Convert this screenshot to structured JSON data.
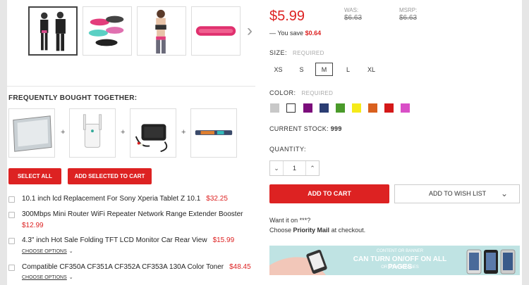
{
  "gallery": {
    "thumbnails": [
      "sportswear-set-thumb",
      "waist-belts-thumb",
      "sports-bra-thumb",
      "pink-belt-thumb"
    ],
    "next_icon": "›"
  },
  "fbt": {
    "title": "FREQUENTLY BOUGHT TOGETHER:",
    "plus": "+",
    "select_all_label": "SELECT ALL",
    "add_selected_label": "ADD SELECTED TO CART",
    "items": [
      {
        "name": "10.1 inch lcd Replacement For Sony Xperia Tablet Z 10.1",
        "price": "$32.25"
      },
      {
        "name": "300Mbps Mini Router WiFi Repeater Network Range Extender Booster",
        "price": "$12.99"
      },
      {
        "name": "4.3\" inch Hot Sale Folding TFT LCD Monitor Car Rear View",
        "price": "$15.99",
        "options": "CHOOSE OPTIONS"
      },
      {
        "name": "Compatible CF350A CF351A CF352A CF353A 130A Color Toner",
        "price": "$48.45",
        "options": "CHOOSE OPTIONS"
      }
    ]
  },
  "price": {
    "current": "$5.99",
    "was_label": "WAS:",
    "was_value": "$6.63",
    "msrp_label": "MSRP:",
    "msrp_value": "$6.63",
    "save_prefix": "— You save",
    "save_amount": "$0.64"
  },
  "size": {
    "label": "SIZE:",
    "required": "REQUIRED",
    "options": [
      "XS",
      "S",
      "M",
      "L",
      "XL"
    ],
    "selected": "M"
  },
  "color": {
    "label": "COLOR:",
    "required": "REQUIRED",
    "swatches": [
      "#c8c8c8",
      "#ffffff",
      "#7b0d7b",
      "#2b3d73",
      "#4a9a2a",
      "#f5ea1a",
      "#d9601e",
      "#d41818",
      "#d94fc7"
    ]
  },
  "stock": {
    "label": "CURRENT STOCK:",
    "value": "999"
  },
  "quantity": {
    "label": "QUANTITY:",
    "value": "1",
    "decrement_icon": "⌄",
    "increment_icon": "⌃"
  },
  "actions": {
    "add_to_cart": "ADD TO CART",
    "wishlist": "ADD TO WISH LIST"
  },
  "shipping": {
    "want_text": "Want it on ***?",
    "choose_prefix": "Choose",
    "choose_bold": "Priority Mail",
    "choose_suffix": "at checkout."
  },
  "banner": {
    "top_text": "CONTENT OR BANNER",
    "main_text": "CAN TURN ON/OFF ON ALL PAGES",
    "bottom_text": "OR OTHER PAGES"
  },
  "colors": {
    "accent": "#d22222"
  }
}
